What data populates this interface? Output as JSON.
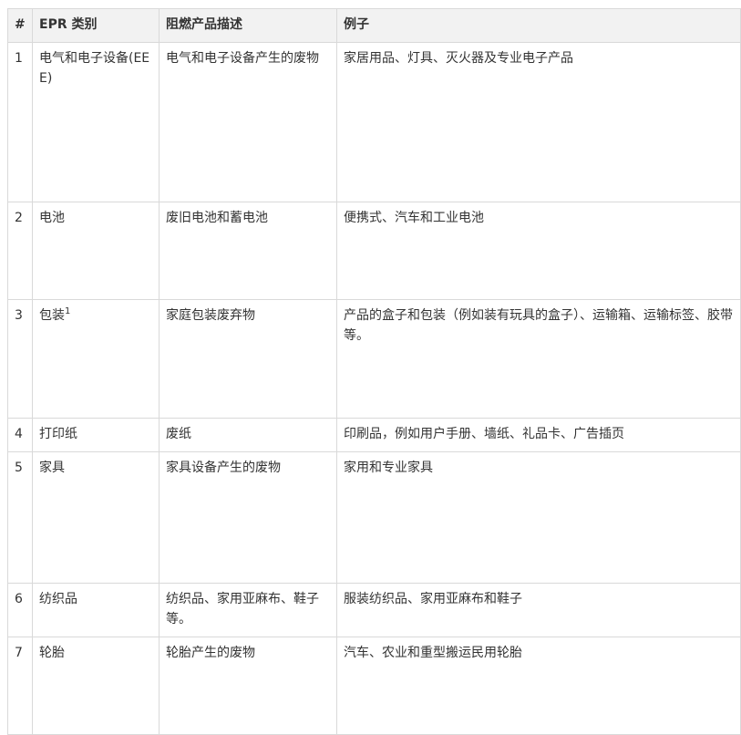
{
  "table": {
    "headers": [
      "#",
      "EPR 类别",
      "阻燃产品描述",
      "例子"
    ],
    "rows": [
      {
        "num": "1",
        "category": "电气和电子设备(EEE)",
        "footnote": "",
        "description": "电气和电子设备产生的废物",
        "examples": "家居用品、灯具、灭火器及专业电子产品"
      },
      {
        "num": "2",
        "category": "电池",
        "footnote": "",
        "description": "废旧电池和蓄电池",
        "examples": "便携式、汽车和工业电池"
      },
      {
        "num": "3",
        "category": "包装",
        "footnote": "1",
        "description": "家庭包装废弃物",
        "examples": "产品的盒子和包装（例如装有玩具的盒子）、运输箱、运输标签、胶带等。"
      },
      {
        "num": "4",
        "category": "打印纸",
        "footnote": "",
        "description": "废纸",
        "examples": "印刷品，例如用户手册、墙纸、礼品卡、广告插页"
      },
      {
        "num": "5",
        "category": "家具",
        "footnote": "",
        "description": "家具设备产生的废物",
        "examples": "家用和专业家具"
      },
      {
        "num": "6",
        "category": "纺织品",
        "footnote": "",
        "description": "纺织品、家用亚麻布、鞋子等。",
        "examples": "服装纺织品、家用亚麻布和鞋子"
      },
      {
        "num": "7",
        "category": "轮胎",
        "footnote": "",
        "description": "轮胎产生的废物",
        "examples": "汽车、农业和重型搬运民用轮胎"
      }
    ]
  }
}
